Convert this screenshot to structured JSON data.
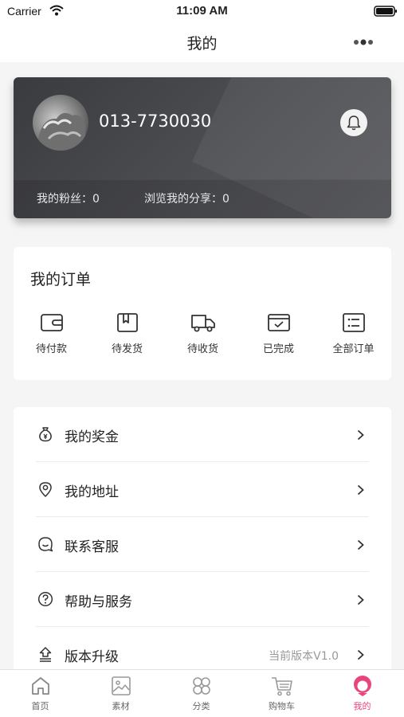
{
  "status_bar": {
    "carrier": "Carrier",
    "time": "11:09 AM"
  },
  "nav": {
    "title": "我的"
  },
  "profile": {
    "phone": "013-7730030",
    "fans": "我的粉丝：0",
    "shares": "浏览我的分享：0"
  },
  "orders": {
    "title": "我的订单",
    "items": [
      {
        "label": "待付款",
        "icon": "wallet-icon"
      },
      {
        "label": "待发货",
        "icon": "package-icon"
      },
      {
        "label": "待收货",
        "icon": "truck-icon"
      },
      {
        "label": "已完成",
        "icon": "check-box-icon"
      },
      {
        "label": "全部订单",
        "icon": "list-icon"
      }
    ]
  },
  "menu": {
    "items": [
      {
        "label": "我的奖金",
        "icon": "money-bag-icon",
        "value": ""
      },
      {
        "label": "我的地址",
        "icon": "location-pin-icon",
        "value": ""
      },
      {
        "label": "联系客服",
        "icon": "chat-icon",
        "value": ""
      },
      {
        "label": "帮助与服务",
        "icon": "help-icon",
        "value": ""
      },
      {
        "label": "版本升级",
        "icon": "upgrade-icon",
        "value": "当前版本V1.0"
      }
    ]
  },
  "tabs": [
    {
      "label": "首页",
      "icon": "home-icon",
      "active": false
    },
    {
      "label": "素材",
      "icon": "image-icon",
      "active": false
    },
    {
      "label": "分类",
      "icon": "category-icon",
      "active": false
    },
    {
      "label": "购物车",
      "icon": "cart-icon",
      "active": false
    },
    {
      "label": "我的",
      "icon": "profile-icon",
      "active": true
    }
  ],
  "colors": {
    "accent": "#e8457c",
    "card_dark": "#46474b",
    "background": "#f5f5f5"
  }
}
